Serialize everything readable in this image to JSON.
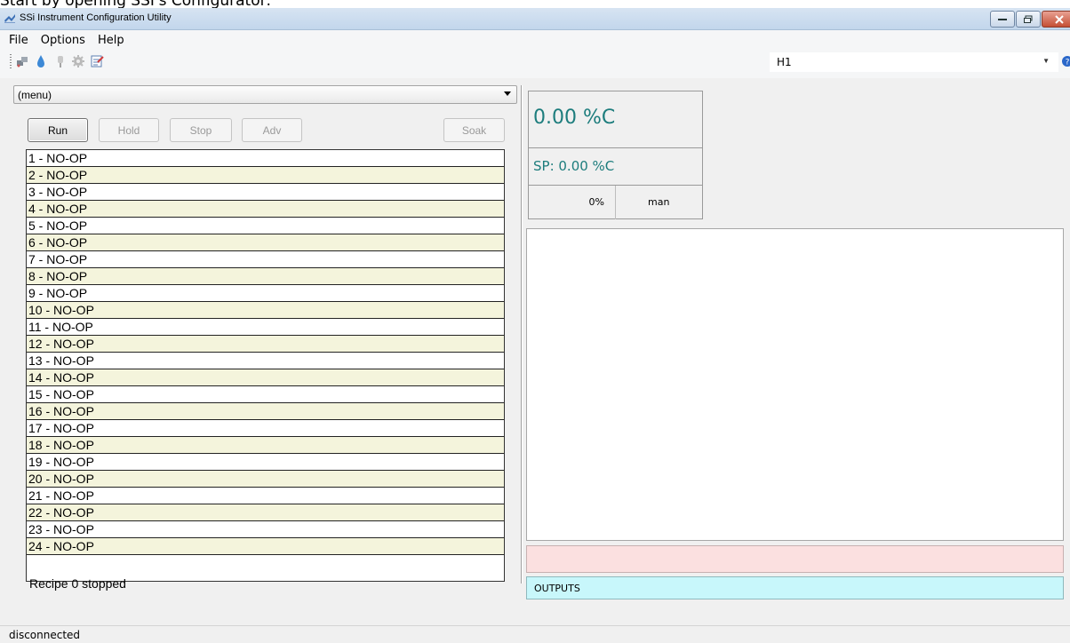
{
  "caption_fragment": "Start by opening SSI's Configurator:",
  "window": {
    "title": "SSi Instrument Configuration Utility"
  },
  "menu": {
    "items": [
      "File",
      "Options",
      "Help"
    ]
  },
  "toolbar": {
    "icons": [
      "connect-icon",
      "drop-icon",
      "probe-icon",
      "gear-icon",
      "notepad-icon"
    ],
    "device_combo_value": "H1"
  },
  "recipe": {
    "menu_select": "(menu)",
    "buttons": {
      "run": "Run",
      "hold": "Hold",
      "stop": "Stop",
      "adv": "Adv",
      "soak": "Soak"
    },
    "steps": [
      "1 - NO-OP",
      "2 - NO-OP",
      "3 - NO-OP",
      "4 - NO-OP",
      "5 - NO-OP",
      "6 - NO-OP",
      "7 - NO-OP",
      "8 - NO-OP",
      "9 - NO-OP",
      "10 - NO-OP",
      "11 - NO-OP",
      "12 - NO-OP",
      "13 - NO-OP",
      "14 - NO-OP",
      "15 - NO-OP",
      "16 - NO-OP",
      "17 - NO-OP",
      "18 - NO-OP",
      "19 - NO-OP",
      "20 - NO-OP",
      "21 - NO-OP",
      "22 - NO-OP",
      "23 - NO-OP",
      "24 - NO-OP"
    ],
    "status": "Recipe 0 stopped"
  },
  "loop": {
    "pv": "0.00 %C",
    "sp": "SP: 0.00 %C",
    "output_pct": "0%",
    "mode": "man"
  },
  "outputs_label": "OUTPUTS",
  "status_bar": "disconnected",
  "colors": {
    "value_teal": "#1d7d7d",
    "step_alt_row": "#f4f4dc",
    "alarm_pink": "#fbe0e0",
    "outputs_cyan": "#c8f7fb"
  }
}
